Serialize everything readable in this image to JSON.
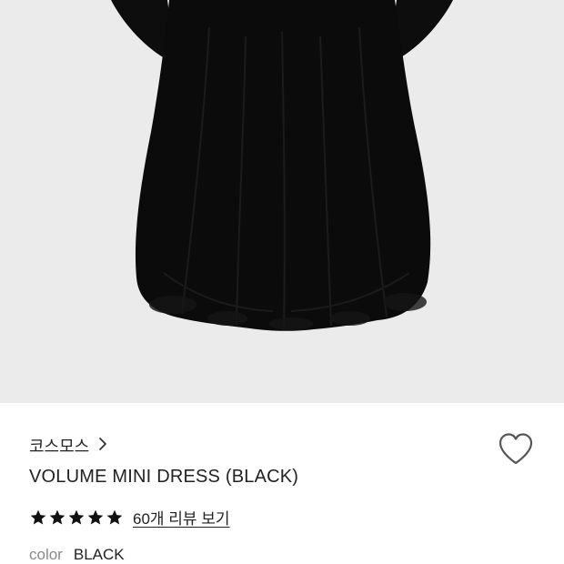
{
  "product": {
    "brand": "코스모스",
    "name": "VOLUME MINI DRESS (BLACK)",
    "rating_stars": 5,
    "reviews_label": "60개 리뷰 보기",
    "color_label": "color",
    "color_value": "BLACK"
  },
  "icons": {
    "brand_chevron": "chevron-right-icon",
    "wishlist": "heart-outline-icon",
    "star": "star-filled-icon"
  },
  "colors": {
    "hero_background": "#ebebeb",
    "dress": "#0b0b0b",
    "text": "#222222",
    "muted": "#8a8a8a"
  }
}
